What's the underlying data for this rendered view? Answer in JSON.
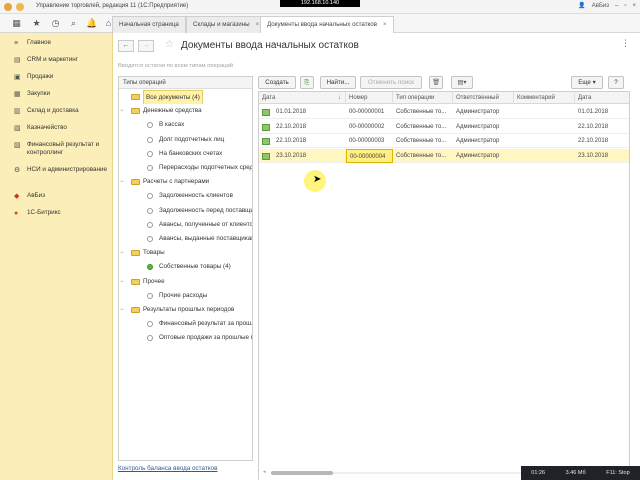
{
  "window": {
    "title": "Управление торговлей, редакция 11 (1С:Предприятие)",
    "remote_ip": "192.168.10.140",
    "user": "АвБиз"
  },
  "tabs": [
    {
      "label": "Начальная страница"
    },
    {
      "label": "Склады и магазины",
      "close": "×"
    },
    {
      "label": "Документы ввода начальных остатков",
      "close": "×"
    }
  ],
  "sidebar": {
    "items": [
      {
        "icon": "menu-lines-icon",
        "label": "Главное"
      },
      {
        "icon": "chart-icon",
        "label": "CRM и маркетинг"
      },
      {
        "icon": "sales-icon",
        "label": "Продажи"
      },
      {
        "icon": "cart-icon",
        "label": "Закупки"
      },
      {
        "icon": "warehouse-icon",
        "label": "Склад и доставка"
      },
      {
        "icon": "treasury-icon",
        "label": "Казначейство"
      },
      {
        "icon": "finance-icon",
        "label": "Финансовый результат и контроллинг"
      },
      {
        "icon": "settings-icon",
        "label": "НСИ и администрирование"
      },
      {
        "icon": "avbiz-icon",
        "label": "АвБиз"
      },
      {
        "icon": "bitrix-icon",
        "label": "1С-Битрикс"
      }
    ]
  },
  "page": {
    "title": "Документы ввода начальных остатков",
    "hint": "Вводятся остатки по всем типам операций",
    "bottom_link": "Контроль баланса ввода остатков",
    "menu_icon": "⋮"
  },
  "operation_types": {
    "header": "Типы операций",
    "rows": [
      {
        "kind": "folder",
        "level": 0,
        "label": "Все документы (4)",
        "selected": true
      },
      {
        "kind": "folder",
        "level": 0,
        "label": "Денежные средства",
        "twisty": "−"
      },
      {
        "kind": "radio",
        "level": 1,
        "label": "В кассах"
      },
      {
        "kind": "radio",
        "level": 1,
        "label": "Долг подотчетных лиц"
      },
      {
        "kind": "radio",
        "level": 1,
        "label": "На банковских счетах"
      },
      {
        "kind": "radio",
        "level": 1,
        "label": "Перерасходы подотчетных средс"
      },
      {
        "kind": "folder",
        "level": 0,
        "label": "Расчеты с партнерами",
        "twisty": "−"
      },
      {
        "kind": "radio",
        "level": 1,
        "label": "Задолженность клиентов"
      },
      {
        "kind": "radio",
        "level": 1,
        "label": "Задолженность перед поставщик"
      },
      {
        "kind": "radio",
        "level": 1,
        "label": "Авансы, полученные от клиентов"
      },
      {
        "kind": "radio",
        "level": 1,
        "label": "Авансы, выданные поставщикам"
      },
      {
        "kind": "folder",
        "level": 0,
        "label": "Товары",
        "twisty": "−"
      },
      {
        "kind": "radio-green",
        "level": 1,
        "label": "Собственные товары (4)"
      },
      {
        "kind": "folder",
        "level": 0,
        "label": "Прочее",
        "twisty": "−"
      },
      {
        "kind": "radio",
        "level": 1,
        "label": "Прочие расходы"
      },
      {
        "kind": "folder",
        "level": 0,
        "label": "Результаты прошлых периодов",
        "twisty": "−"
      },
      {
        "kind": "radio",
        "level": 1,
        "label": "Финансовый результат за прошл"
      },
      {
        "kind": "radio",
        "level": 1,
        "label": "Оптовые продажи за прошлые п"
      }
    ]
  },
  "toolbar": {
    "create": "Создать",
    "find": "Найти...",
    "cancel_search": "Отменить поиск",
    "more": "Еще",
    "help": "?"
  },
  "table": {
    "columns": [
      "Дата",
      "Номер",
      "Тип операции",
      "Ответственный",
      "Комментарий",
      "Дата"
    ],
    "sort_indicator": "↓",
    "rows": [
      {
        "date": "01.01.2018",
        "number": "00-00000001",
        "type": "Собственные то...",
        "responsible": "Администратор",
        "comment": "",
        "date2": "01.01.2018"
      },
      {
        "date": "22.10.2018",
        "number": "00-00000002",
        "type": "Собственные то...",
        "responsible": "Администратор",
        "comment": "",
        "date2": "22.10.2018"
      },
      {
        "date": "22.10.2018",
        "number": "00-00000003",
        "type": "Собственные то...",
        "responsible": "Администратор",
        "comment": "",
        "date2": "22.10.2018"
      },
      {
        "date": "23.10.2018",
        "number": "00-00000004",
        "type": "Собственные то...",
        "responsible": "Администратор",
        "comment": "",
        "date2": "23.10.2018",
        "selected": true
      }
    ]
  },
  "tray": {
    "time": "01:26",
    "size": "3.46 Мб",
    "hint": "F11: Stop"
  },
  "colors": {
    "sidebar_bg": "#fbeeb8",
    "selection": "#fff6c2",
    "link": "#2c5a9b"
  }
}
